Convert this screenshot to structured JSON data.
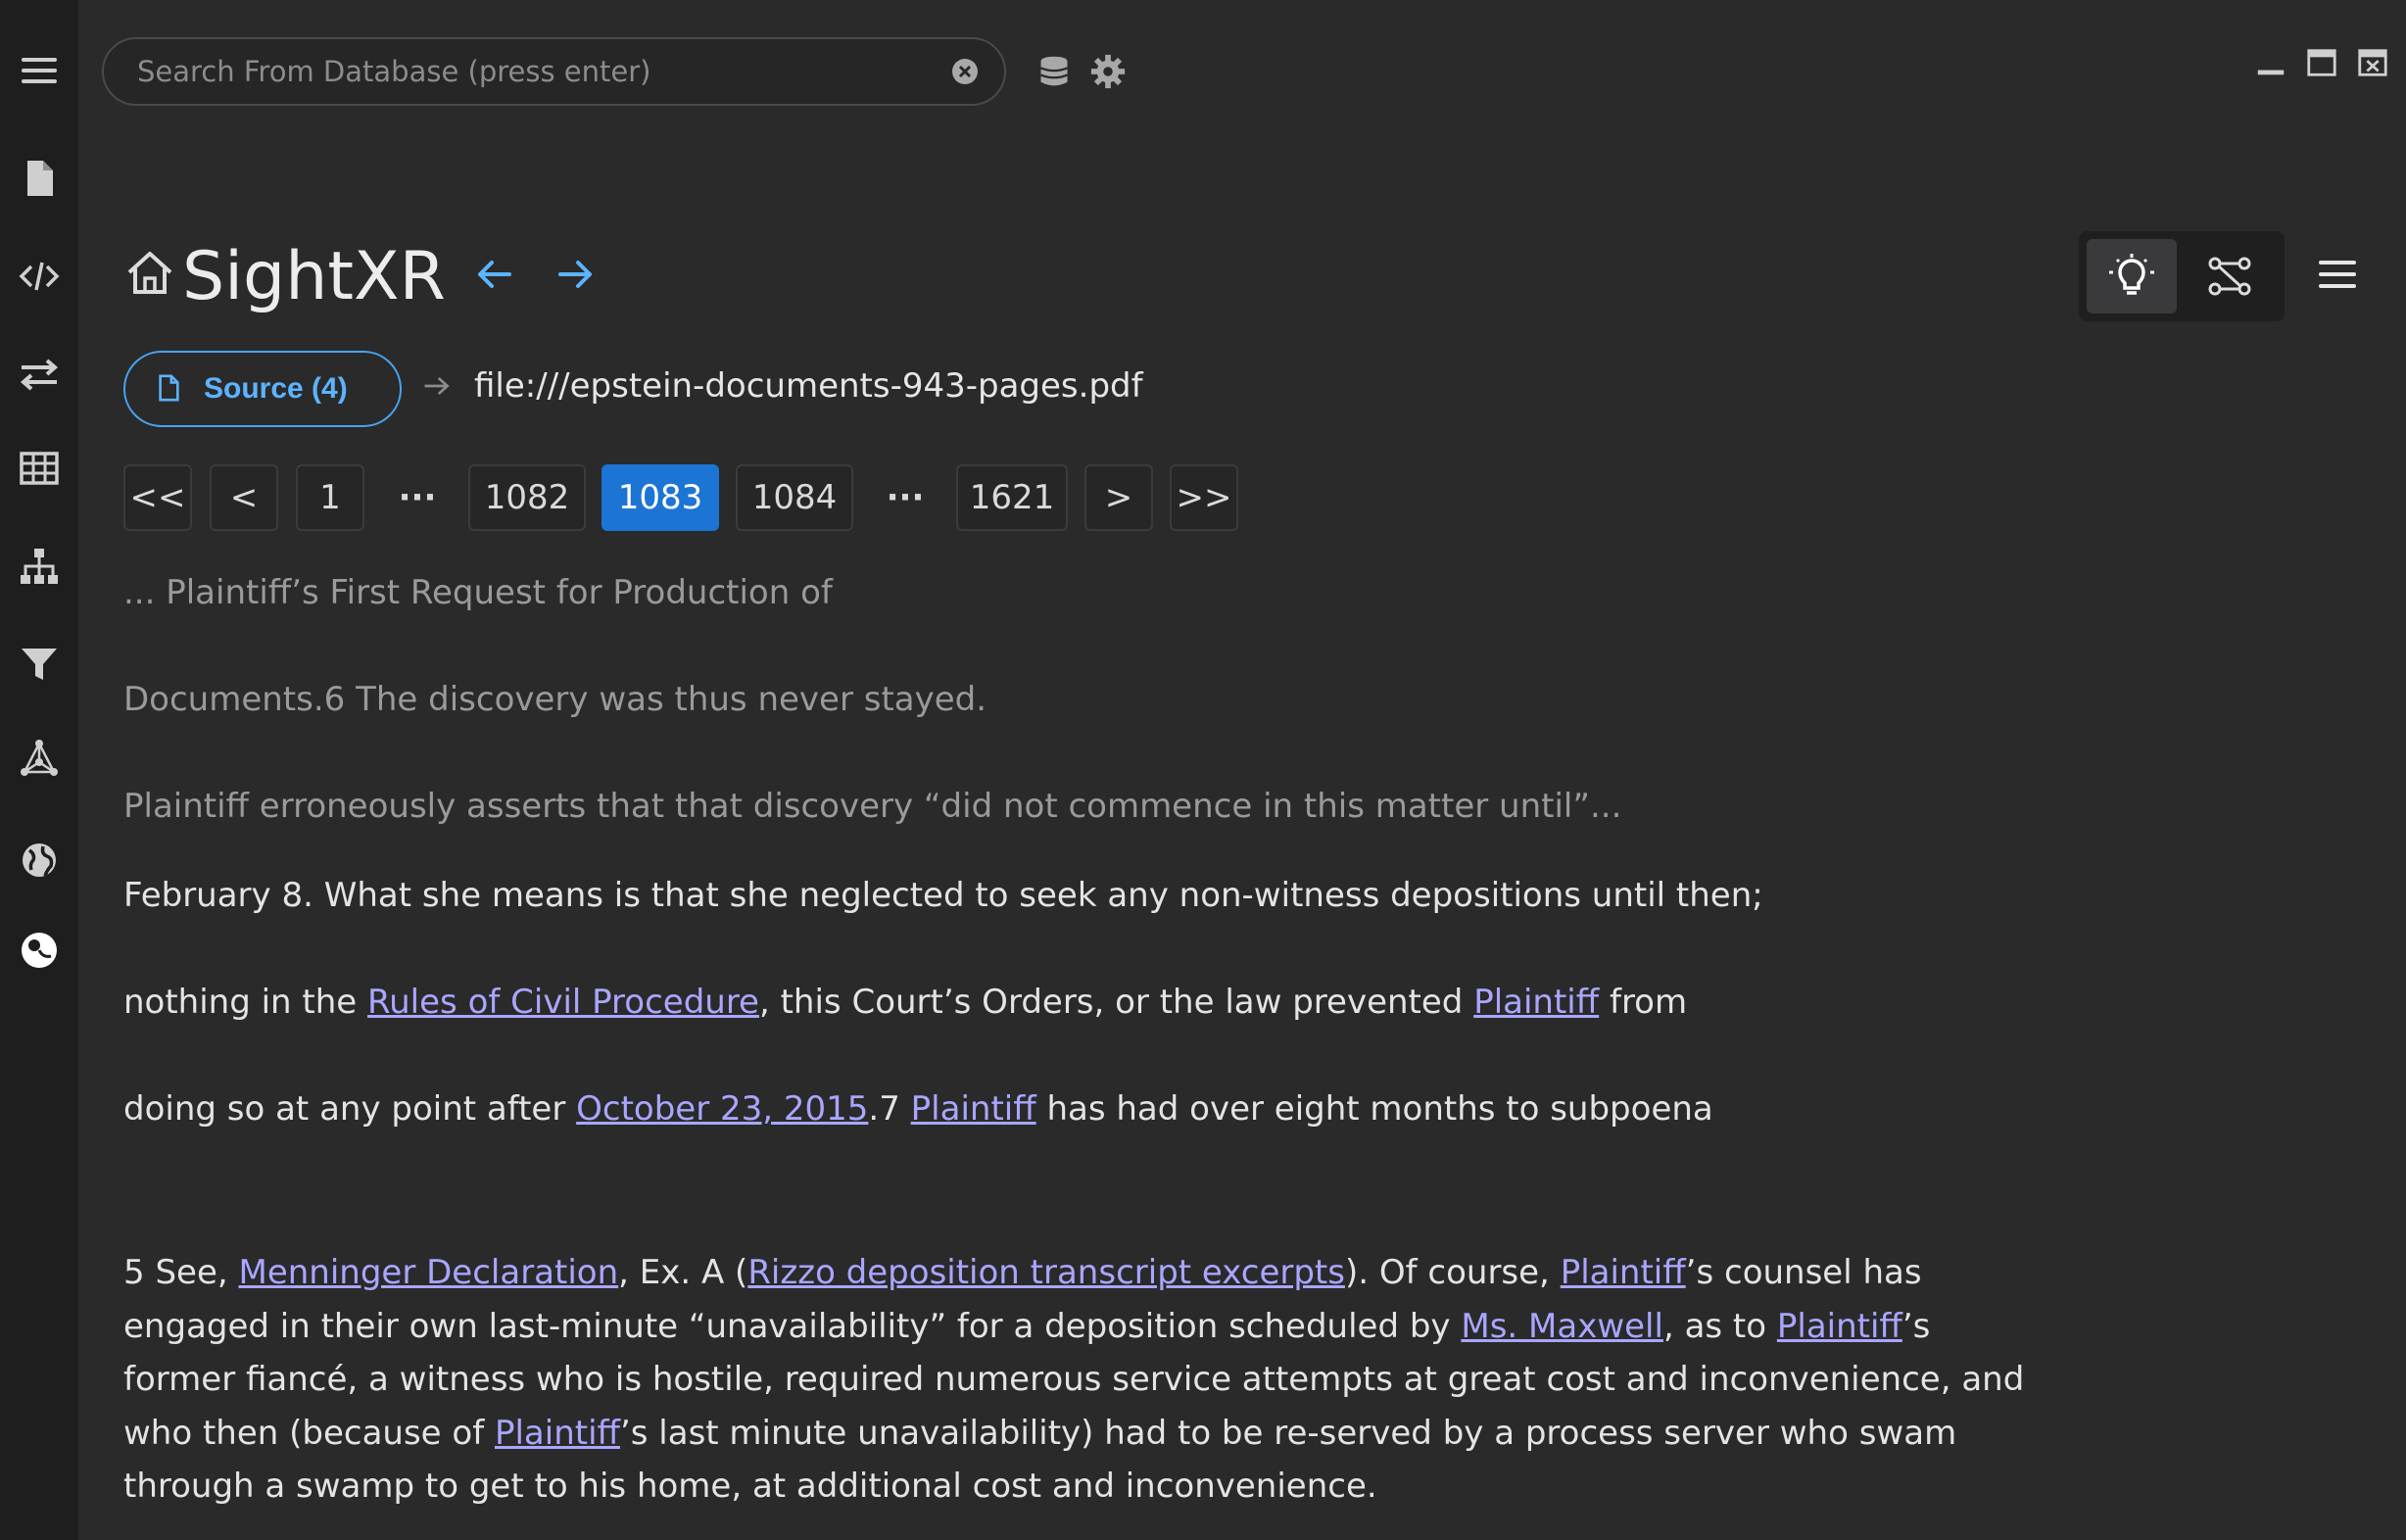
{
  "search": {
    "placeholder": "Search From Database (press enter)",
    "value": ""
  },
  "app": {
    "title": "SightXR"
  },
  "source": {
    "label": "Source (4)",
    "path": "file:///epstein-documents-943-pages.pdf"
  },
  "pagination": {
    "first": "<<",
    "prev": "<",
    "next": ">",
    "last": ">>",
    "pages": [
      "1",
      "1082",
      "1083",
      "1084",
      "1621"
    ],
    "current": "1083",
    "ellipsis": "···"
  },
  "doc": {
    "line1": "... Plaintiff’s First Request for Production of",
    "line2": "Documents.6 The discovery was thus never stayed.",
    "line3": "Plaintiff erroneously asserts that that discovery “did not commence in this matter until”...",
    "line4": "February 8. What she means is that she neglected to seek any non-witness depositions until then;",
    "line5": {
      "a": "nothing in the ",
      "link1": "Rules of Civil Procedure",
      "b": ", this Court’s Orders, or the law prevented ",
      "link2": "Plaintiff",
      "c": " from"
    },
    "line6": {
      "a": "doing so at any point after ",
      "link1": "October 23, 2015",
      "b": ".7 ",
      "link2": "Plaintiff",
      "c": " has had over eight months to subpoena"
    },
    "footnote": {
      "t1": "5 See, ",
      "l1": "Menninger Declaration",
      "t2": ", Ex. A (",
      "l2": "Rizzo deposition transcript excerpts",
      "t3": "). Of course, ",
      "l3": "Plaintiff",
      "t4": "’s counsel has engaged in their own last-minute “unavailability” for a deposition scheduled by ",
      "l4": "Ms. Maxwell",
      "t5": ", as to ",
      "l5": "Plaintiff",
      "t6": "’s former fiancé, a witness who is hostile, required numerous service attempts at great cost and inconvenience, and who then (because of ",
      "l6": "Plaintiff",
      "t7": "’s last minute unavailability) had to be re-served by a process server who swam through a swamp to get to his home, at additional cost and inconvenience."
    }
  },
  "colors": {
    "accent": "#1c74d4",
    "link": "#a9a6ff",
    "sourceBorder": "#4aa3f0",
    "navArrow": "#5cb3ff"
  },
  "icons": {
    "sidebar": [
      "menu-icon",
      "document-icon",
      "code-icon",
      "transfer-icon",
      "table-icon",
      "hierarchy-icon",
      "filter-icon",
      "network-icon",
      "globe-icon",
      "theme-icon"
    ],
    "top": [
      "clear-icon",
      "database-icon",
      "gear-icon",
      "minimize-icon",
      "maximize-icon",
      "close-icon"
    ],
    "toolbar": [
      "home-icon",
      "arrow-left-icon",
      "arrow-right-icon",
      "lightbulb-icon",
      "graph-icon",
      "hamburger-menu-icon",
      "file-icon"
    ]
  }
}
